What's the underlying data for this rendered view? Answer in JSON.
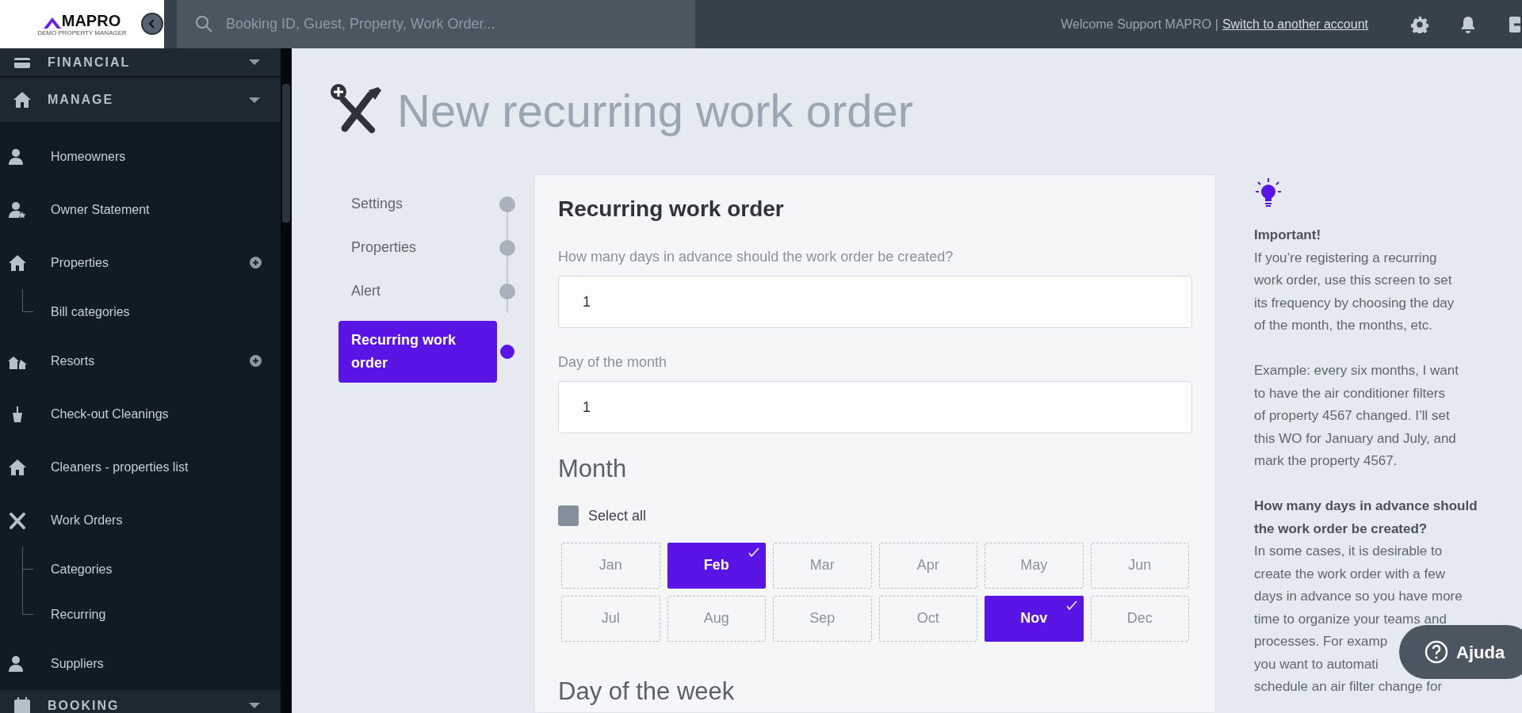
{
  "header": {
    "logo": {
      "name": "MAPRO",
      "subtitle": "DEMO PROPERTY MANAGER"
    },
    "search": {
      "placeholder": "Booking ID, Guest, Property, Work Order..."
    },
    "welcome": "Welcome Support MAPRO |",
    "switch_link": "Switch to another account"
  },
  "sidebar": {
    "sections": [
      {
        "label": "FINANCIAL",
        "expanded": false
      },
      {
        "label": "MANAGE",
        "expanded": true,
        "items": [
          {
            "label": "Homeowners"
          },
          {
            "label": "Owner Statement"
          },
          {
            "label": "Properties",
            "add_button": true,
            "children": [
              {
                "label": "Bill categories"
              }
            ]
          },
          {
            "label": "Resorts",
            "add_button": true
          },
          {
            "label": "Check-out Cleanings"
          },
          {
            "label": "Cleaners - properties list"
          },
          {
            "label": "Work Orders",
            "children": [
              {
                "label": "Categories"
              },
              {
                "label": "Recurring"
              }
            ]
          },
          {
            "label": "Suppliers"
          }
        ]
      },
      {
        "label": "BOOKING",
        "expanded": false
      }
    ]
  },
  "page_title": "New recurring work order",
  "steps": [
    {
      "label": "Settings",
      "selected": false
    },
    {
      "label": "Properties",
      "selected": false
    },
    {
      "label": "Alert",
      "selected": false
    },
    {
      "label": "Recurring work order",
      "selected": true
    }
  ],
  "form": {
    "title": "Recurring work order",
    "fields": [
      {
        "label": "How many days in advance should the work order be created?",
        "value": "1"
      },
      {
        "label": "Day of the month",
        "value": "1"
      }
    ],
    "month_heading": "Month",
    "select_all": {
      "label": "Select all",
      "checked": false
    },
    "months": [
      {
        "label": "Jan",
        "selected": false
      },
      {
        "label": "Feb",
        "selected": true
      },
      {
        "label": "Mar",
        "selected": false
      },
      {
        "label": "Apr",
        "selected": false
      },
      {
        "label": "May",
        "selected": false
      },
      {
        "label": "Jun",
        "selected": false
      },
      {
        "label": "Jul",
        "selected": false
      },
      {
        "label": "Aug",
        "selected": false
      },
      {
        "label": "Sep",
        "selected": false
      },
      {
        "label": "Oct",
        "selected": false
      },
      {
        "label": "Nov",
        "selected": true
      },
      {
        "label": "Dec",
        "selected": false
      }
    ],
    "week_heading": "Day of the week"
  },
  "help": {
    "paragraphs": [
      {
        "title": "Important!",
        "text": "If you’re registering a recurring\nwork order, use this screen to set\nits frequency by choosing the day\nof the month, the months, etc."
      },
      {
        "text": "Example: every six months, I want\nto have the air conditioner filters\nof property 4567 changed. I’ll set\nthis WO for January and July, and\nmark the property 4567."
      },
      {
        "title": "How many days in advance should\nthe work order be created?",
        "text": "In some cases, it is desirable to\ncreate the work order with a few\ndays in advance so you have more\ntime to organize your teams and",
        "cut_lines": [
          "processes. For examp",
          "you want to automati",
          "schedule an air filter change for"
        ]
      }
    ]
  },
  "help_button": {
    "label": "Ajuda"
  }
}
